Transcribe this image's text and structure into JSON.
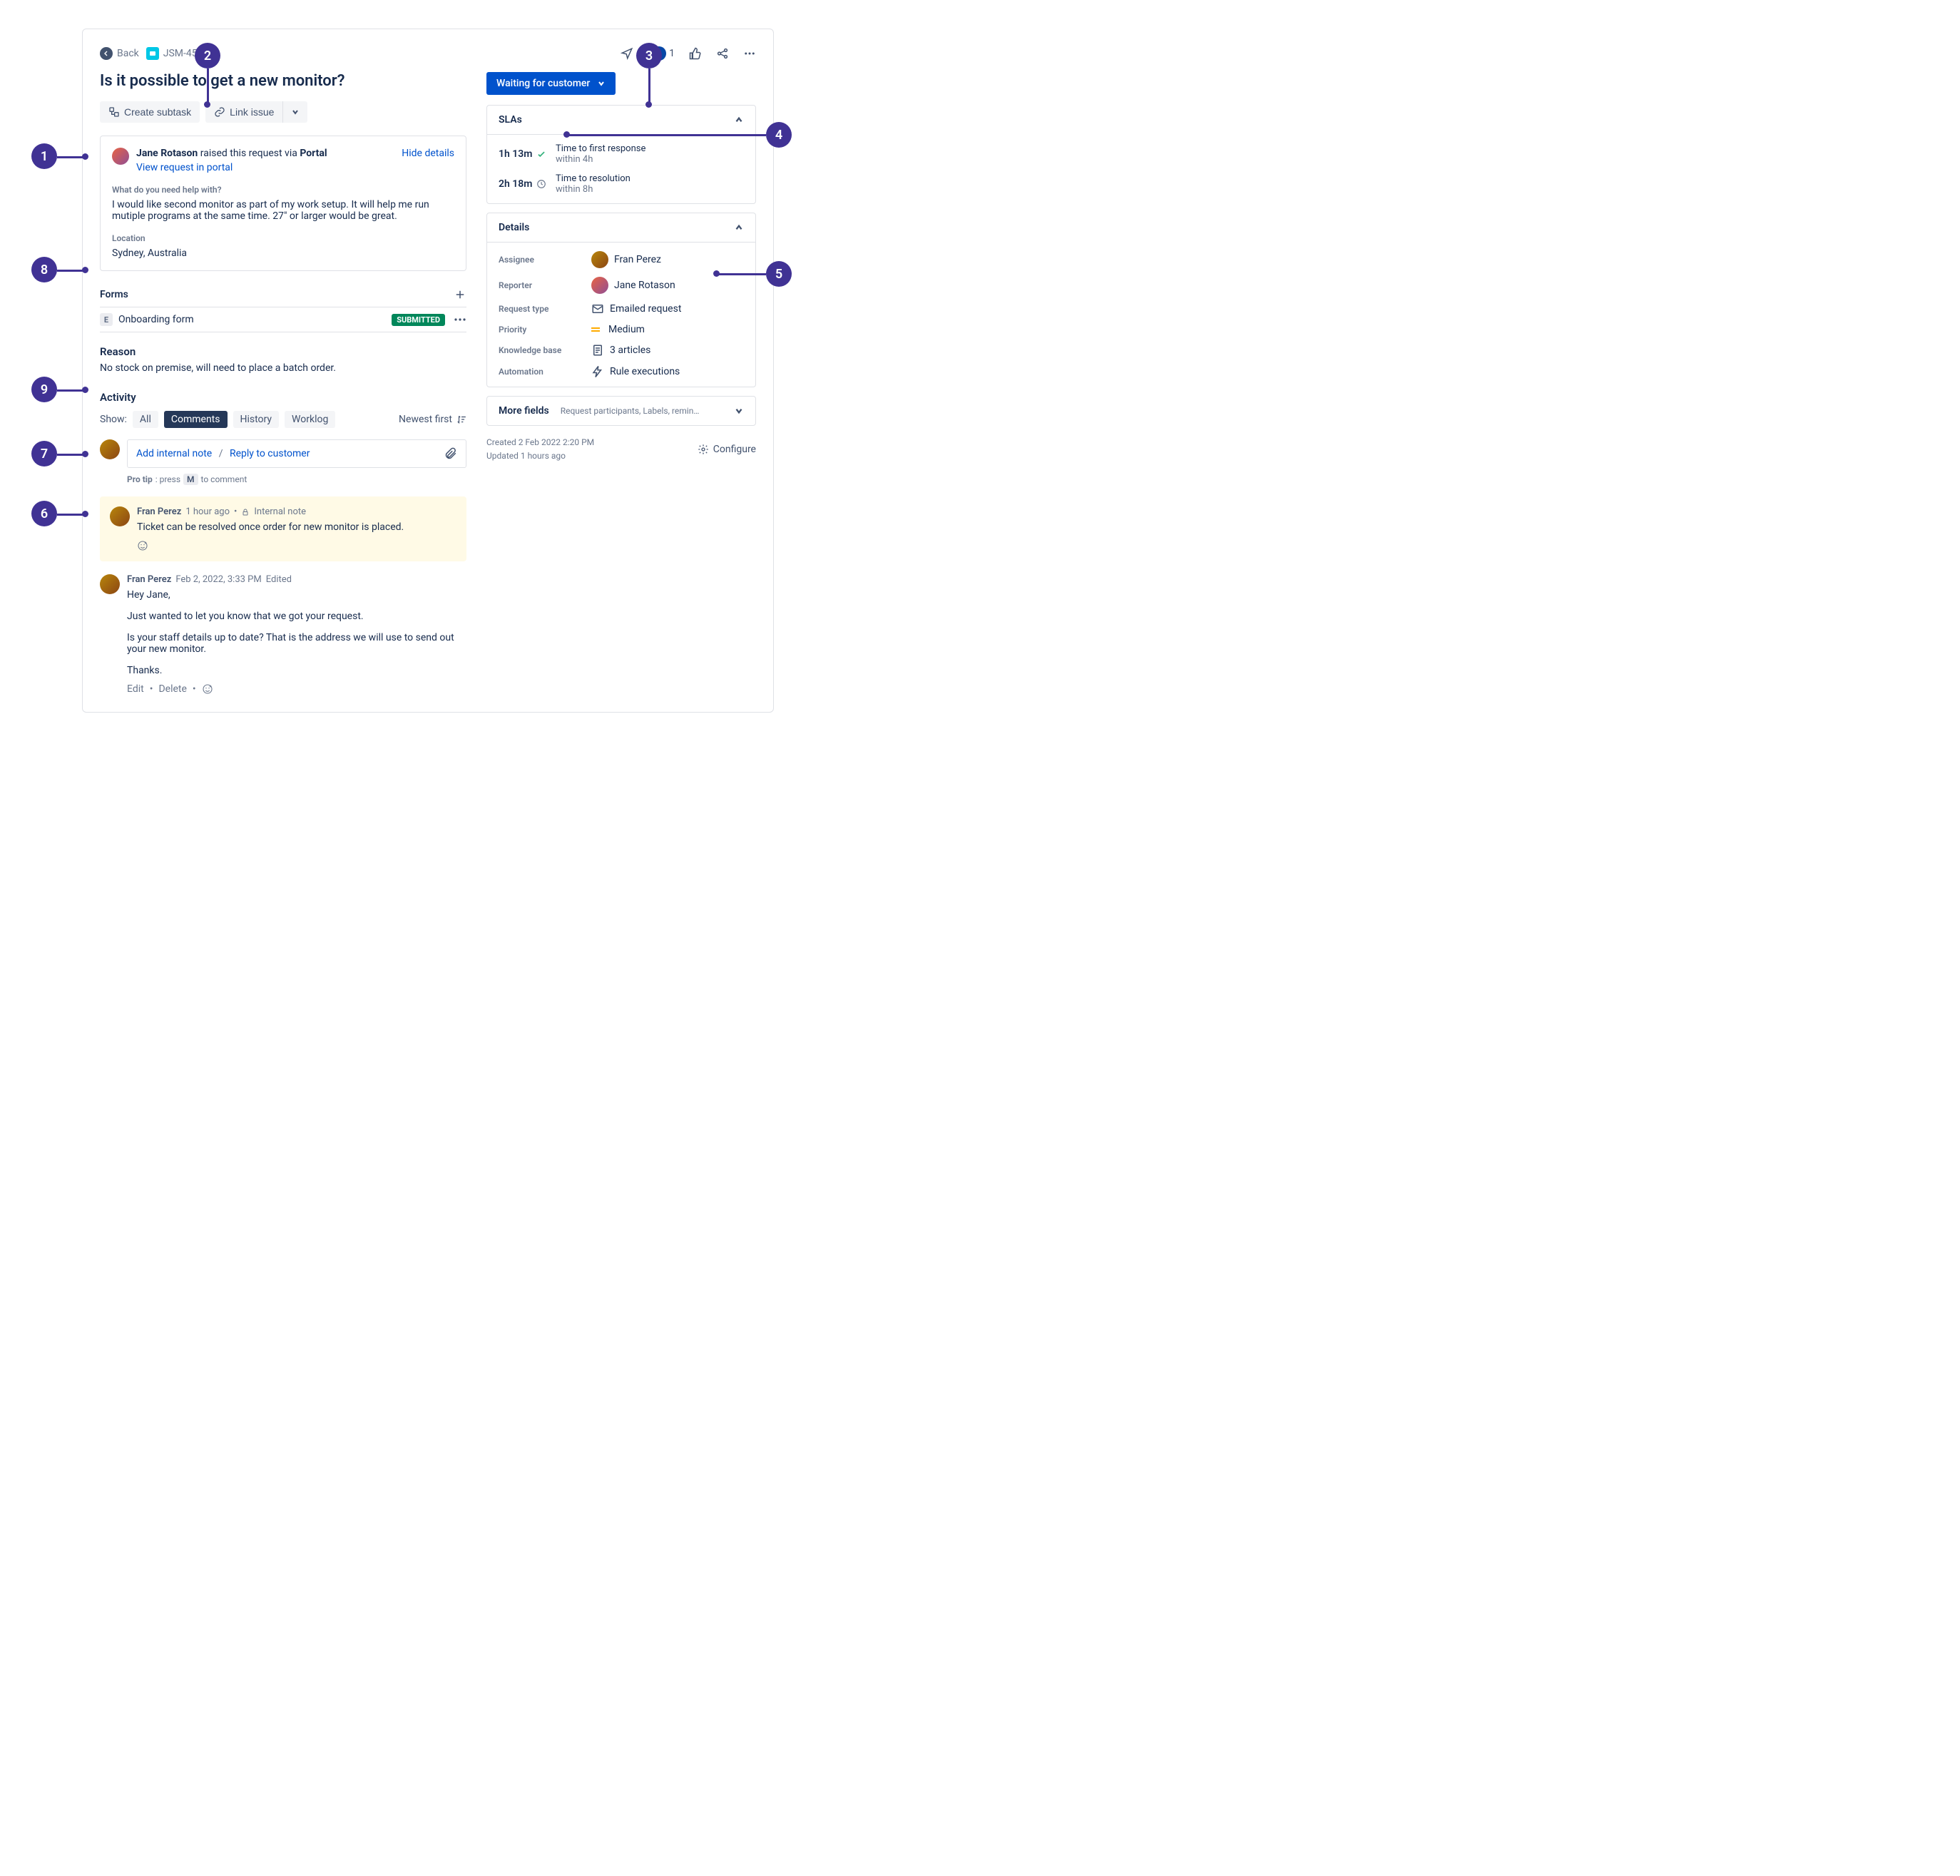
{
  "breadcrumb": {
    "back": "Back",
    "issue_key": "JSM-456"
  },
  "top_actions": {
    "watchers": "1"
  },
  "title": "Is it possible to get a new monitor?",
  "quick_actions": {
    "create_subtask": "Create subtask",
    "link_issue": "Link issue"
  },
  "request": {
    "reporter_name": "Jane Rotason",
    "raised_via_pre": " raised this request via ",
    "raised_via_channel": "Portal",
    "hide_details": "Hide details",
    "view_in_portal": "View request in portal",
    "q_label": "What do you need help with?",
    "q_body": "I would like second monitor as part of my work setup. It will help me run mutiple programs at the same time. 27\" or larger would be great.",
    "location_label": "Location",
    "location_value": "Sydney, Australia"
  },
  "forms": {
    "heading": "Forms",
    "item": "Onboarding form",
    "status": "SUBMITTED"
  },
  "reason": {
    "heading": "Reason",
    "body": "No stock on premise, will need to place a batch order."
  },
  "activity": {
    "heading": "Activity",
    "show_label": "Show:",
    "tabs": {
      "all": "All",
      "comments": "Comments",
      "history": "History",
      "worklog": "Worklog"
    },
    "sort": "Newest first",
    "add_internal_note": "Add internal note",
    "sep": "/",
    "reply_to_customer": "Reply to customer",
    "pro_tip_pre": "Pro tip",
    "pro_tip_mid": ": press ",
    "pro_tip_key": "M",
    "pro_tip_post": " to comment",
    "note": {
      "author": "Fran Perez",
      "time": "1 hour ago",
      "dot": "•",
      "internal_label": "Internal note",
      "body": "Ticket can be resolved once order for new monitor is placed."
    },
    "comment": {
      "author": "Fran Perez",
      "time": "Feb 2, 2022, 3:33 PM",
      "edited": "Edited",
      "p1": "Hey Jane,",
      "p2": "Just wanted to let you know that we got your request.",
      "p3": "Is your staff details up to date? That is the address we will use to send out your new monitor.",
      "p4": "Thanks.",
      "edit": "Edit",
      "delete": "Delete"
    }
  },
  "status": {
    "label": "Waiting for customer"
  },
  "slas": {
    "heading": "SLAs",
    "rows": [
      {
        "time": "1h 13m",
        "title": "Time to first response",
        "sub": "within 4h",
        "ok": true
      },
      {
        "time": "2h 18m",
        "title": "Time to resolution",
        "sub": "within 8h",
        "ok": false
      }
    ]
  },
  "details": {
    "heading": "Details",
    "assignee_label": "Assignee",
    "assignee": "Fran Perez",
    "reporter_label": "Reporter",
    "reporter": "Jane Rotason",
    "request_type_label": "Request type",
    "request_type": "Emailed request",
    "priority_label": "Priority",
    "priority": "Medium",
    "kb_label": "Knowledge base",
    "kb": "3 articles",
    "automation_label": "Automation",
    "automation": "Rule executions"
  },
  "more_fields": {
    "label": "More fields",
    "sub": "Request participants, Labels, reminders, pr…"
  },
  "meta": {
    "created": "Created 2 Feb 2022 2:20 PM",
    "updated": "Updated 1 hours ago",
    "configure": "Configure"
  },
  "annotations": {
    "n1": "1",
    "n2": "2",
    "n3": "3",
    "n4": "4",
    "n5": "5",
    "n6": "6",
    "n7": "7",
    "n8": "8",
    "n9": "9"
  }
}
